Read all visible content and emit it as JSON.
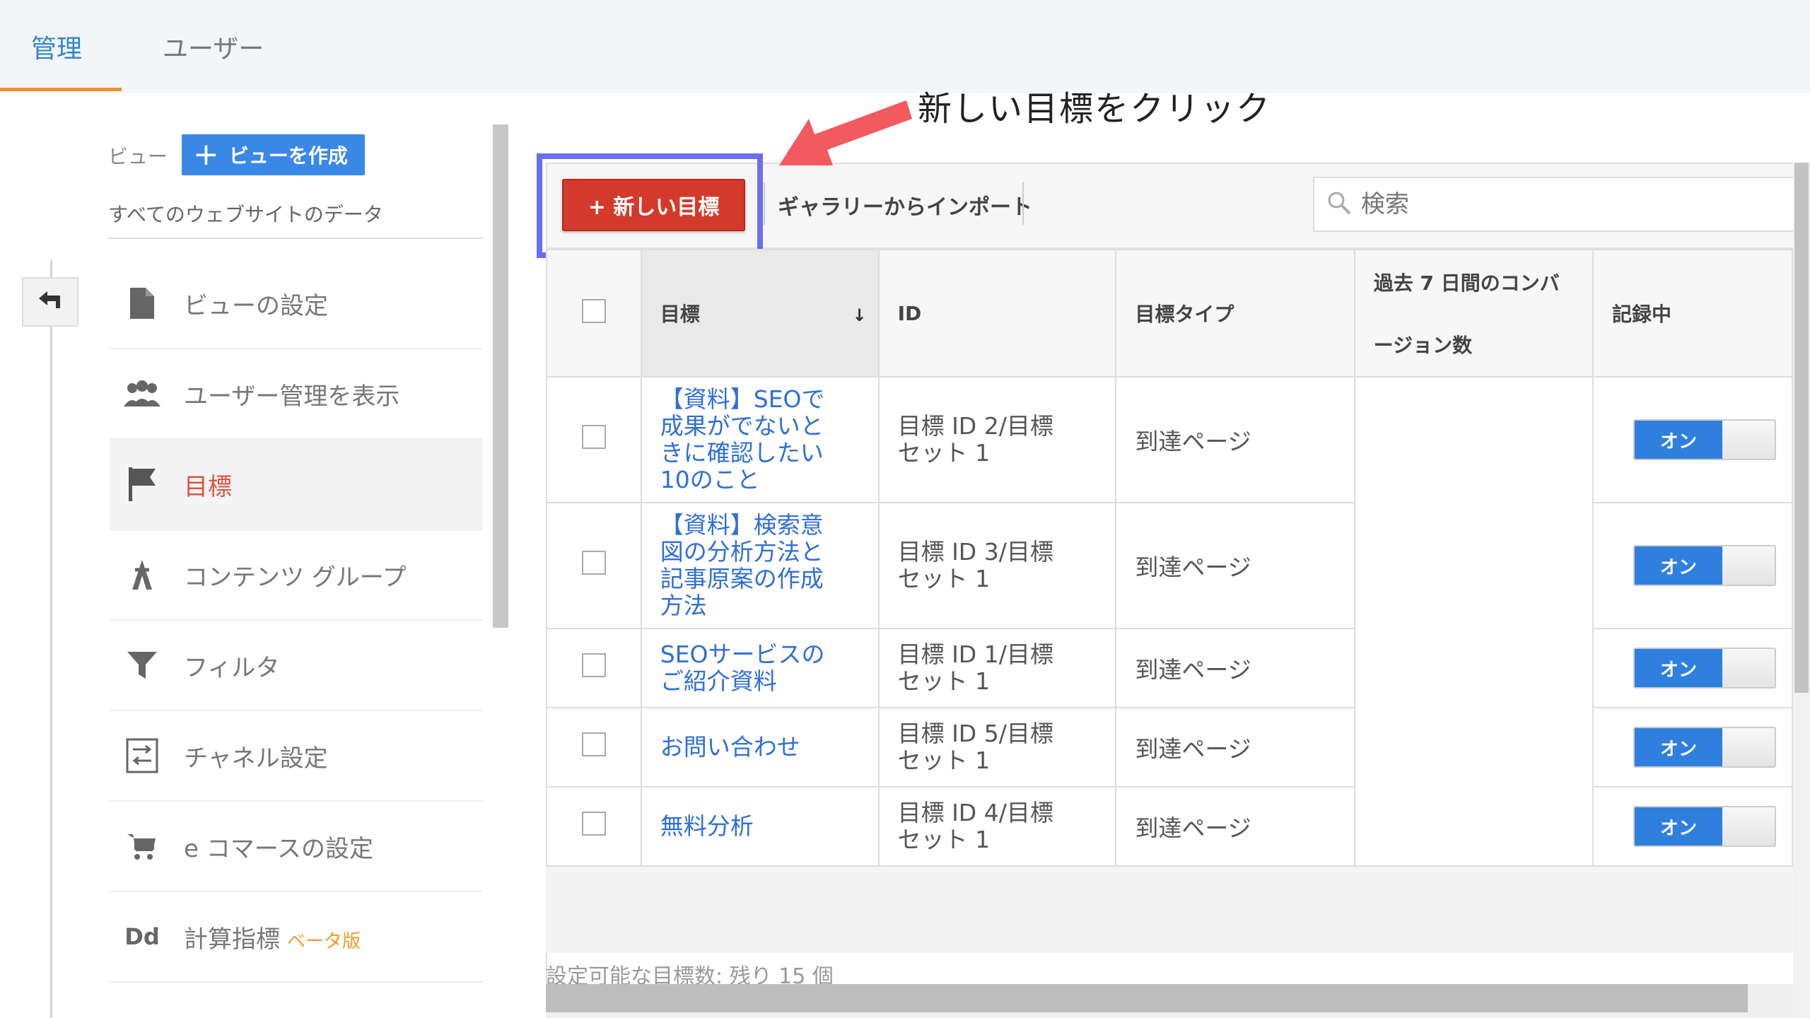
{
  "tabs": [
    {
      "label": "管理",
      "active": true
    },
    {
      "label": "ユーザー",
      "active": false
    }
  ],
  "sidebar": {
    "view_label": "ビュー",
    "create_view_label": "ビューを作成",
    "view_name": "すべてのウェブサイトのデータ",
    "items": [
      {
        "label": "ビューの設定",
        "icon": "document-icon"
      },
      {
        "label": "ユーザー管理を表示",
        "icon": "people-icon"
      },
      {
        "label": "目標",
        "icon": "flag-icon",
        "active": true
      },
      {
        "label": "コンテンツ グループ",
        "icon": "content-group-icon"
      },
      {
        "label": "フィルタ",
        "icon": "filter-icon"
      },
      {
        "label": "チャネル設定",
        "icon": "channel-settings-icon"
      },
      {
        "label": "e コマースの設定",
        "icon": "cart-icon"
      },
      {
        "label": "計算指標",
        "badge": "ベータ版",
        "icon_text": "Dd"
      }
    ]
  },
  "annotation": {
    "text": "新しい目標をクリック"
  },
  "toolbar": {
    "new_goal_label": "+ 新しい目標",
    "import_label": "ギャラリーからインポート",
    "search_placeholder": "検索"
  },
  "table": {
    "headers": {
      "goal": "目標",
      "sort_indicator": "↓",
      "id": "ID",
      "type": "目標タイプ",
      "conv_line1": "過去 7 日間のコンバ",
      "conv_line2": "ージョン数",
      "recording": "記録中"
    },
    "rows": [
      {
        "goal": "【資料】SEOで成果がでないときに確認したい10のこと",
        "id": "目標 ID 2/目標セット 1",
        "type": "到達ページ",
        "recording": "オン"
      },
      {
        "goal": "【資料】検索意図の分析方法と記事原案の作成方法",
        "id": "目標 ID 3/目標セット 1",
        "type": "到達ページ",
        "recording": "オン"
      },
      {
        "goal": "SEOサービスのご紹介資料",
        "id": "目標 ID 1/目標セット 1",
        "type": "到達ページ",
        "recording": "オン"
      },
      {
        "goal": "お問い合わせ",
        "id": "目標 ID 5/目標セット 1",
        "type": "到達ページ",
        "recording": "オン"
      },
      {
        "goal": "無料分析",
        "id": "目標 ID 4/目標セット 1",
        "type": "到達ページ",
        "recording": "オン"
      }
    ]
  },
  "footer": {
    "remaining_text": "設定可能な目標数: 残り 15 個"
  },
  "colors": {
    "accent_blue": "#2f7fde",
    "new_goal_red": "#d33a2c",
    "highlight_border": "#6b6ef0",
    "arrow_red": "#f25a5f",
    "tab_underline": "#f0912d"
  }
}
